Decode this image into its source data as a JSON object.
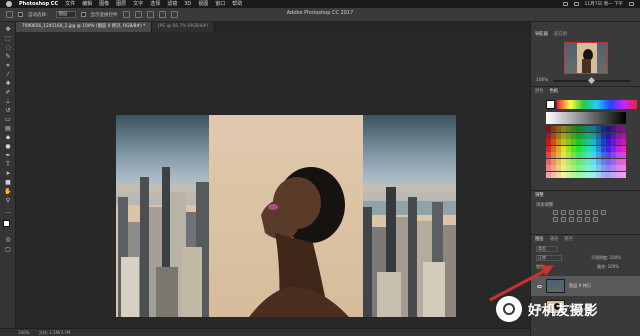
{
  "menubar": {
    "app_name": "Photoshop CC",
    "items": [
      "文件",
      "编辑",
      "图像",
      "图层",
      "文字",
      "选择",
      "滤镜",
      "3D",
      "视图",
      "窗口",
      "帮助"
    ],
    "clock": "11月7日 周一 下午"
  },
  "window_title": "Adobe Photoshop CC 2017",
  "options_bar": {
    "auto_select_label": "自动选择：",
    "auto_select_value": "图层",
    "show_transform_label": "显示变换控件"
  },
  "tabs": [
    {
      "label": "7090656_1245160_2.jpg @ 100% (图层 0 拷贝, RGB/8#) *",
      "active": true
    },
    {
      "label": "JPG @ 66.7% (RGB/8#)",
      "active": false
    }
  ],
  "status": {
    "zoom": "100%",
    "doc_info": "文档: 1.5M/3.7M"
  },
  "panels": {
    "navigator_tabs": [
      "导航器",
      "直方图"
    ],
    "navigator_zoom": "100%",
    "color_tabs": [
      "颜色",
      "色板"
    ],
    "adjust_tab": "调整",
    "adjust_hint": "添加调整",
    "layers_tabs": [
      "图层",
      "通道",
      "路径"
    ],
    "layers_kind": "类型",
    "blend_mode": "正常",
    "opacity_label": "不透明度: 100%",
    "lock_label": "锁定:",
    "fill_label": "填充: 100%",
    "layers": [
      {
        "name": "图层 0 拷贝",
        "selected": true
      },
      {
        "name": "图层 0",
        "selected": false
      }
    ]
  },
  "watermark": {
    "text": "好机友摄影"
  },
  "colors": {
    "accent_red": "#c8332f",
    "panel_bg": "#3a3a3a",
    "canvas_bg": "#282828"
  }
}
